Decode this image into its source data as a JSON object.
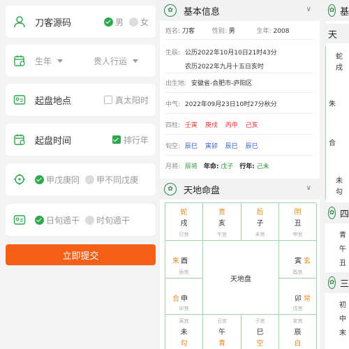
{
  "form": {
    "name_value": "刀客源码",
    "gender": {
      "male": "男",
      "female": "女"
    },
    "birth_year_placeholder": "生年",
    "luck_placeholder": "贵人行运",
    "place_label": "起盘地点",
    "true_solar_label": "真太阳时",
    "time_label": "起盘时间",
    "order_label": "排行年",
    "opt1": "甲戊庚同",
    "opt2": "甲不同戊庚",
    "opt3": "日旬遁干",
    "opt4": "时旬遁干",
    "submit_label": "立即提交"
  },
  "basic": {
    "title": "基本信息",
    "name_key": "姓名:",
    "name_val": "刀客",
    "gender_key": "性别:",
    "gender_val": "男",
    "year_key": "生年:",
    "year_val": "2008",
    "date_key": "生辰:",
    "solar": "公历2022年10月10日21时43分",
    "lunar": "农历2022年九月十五日亥时",
    "place_key": "出生地:",
    "place_val": "安徽省-合肥市-庐阳区",
    "qi_key": "中气:",
    "qi_val": "2022年09月23日10时27分秋分",
    "pillars_key": "四柱:",
    "pillars": [
      "壬寅",
      "庚戌",
      "丙申",
      "己亥"
    ],
    "xunkong_key": "旬空:",
    "xunkong": [
      "辰巳",
      "寅卯",
      "辰巳",
      "辰巳"
    ],
    "month_key": "月将:",
    "month_val": "辰将",
    "life_key": "年命:",
    "life_val": "戊子",
    "xing_key": "行年:",
    "xing_val": "己未"
  },
  "pan": {
    "title": "天地命盘",
    "center": "天地盘",
    "top_gods": [
      "蛇",
      "贵",
      "后",
      "阴"
    ],
    "top_branch": [
      "戌",
      "亥",
      "子",
      "丑"
    ],
    "top_xun": [
      "巳宫",
      "午宫",
      "未宫",
      "申宫"
    ],
    "left_mid1": {
      "god": "朱",
      "branch": "酉",
      "xun": "辰宫"
    },
    "left_mid2": {
      "god": "合",
      "branch": "申",
      "xun": "卯宫"
    },
    "right_mid1": {
      "branch": "寅",
      "god": "玄",
      "xun": "酉宫"
    },
    "right_mid2": {
      "branch": "卯",
      "god": "常",
      "xun": "戌宫"
    },
    "bottom_xun": [
      "寅宫",
      "丑宫",
      "子宫",
      "亥宫"
    ],
    "bottom_branch": [
      "未",
      "午",
      "巳",
      "辰"
    ],
    "bottom_gods": [
      "勾",
      "青",
      "空",
      "白"
    ]
  },
  "right_strip": {
    "r1": "基",
    "r2": "天",
    "r3": "四",
    "r4": "三",
    "c1": "蛇",
    "c2": "戌",
    "c3": "朱",
    "c4": "合",
    "c5": "未",
    "c6": "勾",
    "c7": "青",
    "c8": "午",
    "c9": "丑",
    "c10": "初",
    "c11": "中",
    "c12": "末"
  },
  "colors": {
    "accent": "#2fa74f",
    "submit": "#f35f16",
    "grid": "#9fd3ae"
  }
}
